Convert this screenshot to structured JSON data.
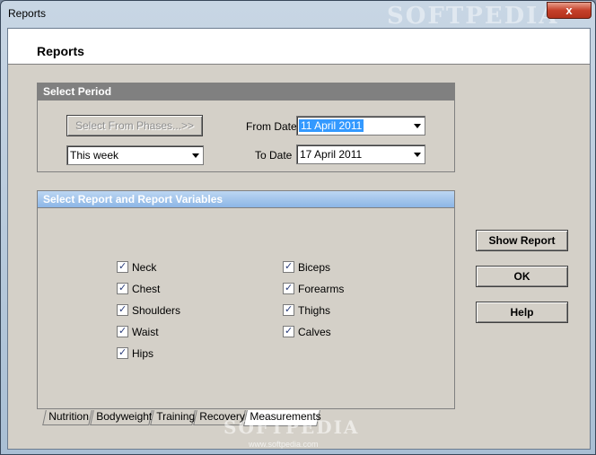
{
  "window": {
    "title": "Reports",
    "watermark": "SOFTPEDIA",
    "close_label": "x"
  },
  "header": {
    "title": "Reports"
  },
  "select_period": {
    "title": "Select Period",
    "phases_button": "Select From Phases...>>",
    "range_select": "This week",
    "from_label": "From Date",
    "from_value": "11 April 2011",
    "to_label": "To Date",
    "to_value": "17 April 2011"
  },
  "report_vars": {
    "title": "Select Report and Report Variables",
    "left": [
      {
        "label": "Neck",
        "checked": true
      },
      {
        "label": "Chest",
        "checked": true
      },
      {
        "label": "Shoulders",
        "checked": true
      },
      {
        "label": "Waist",
        "checked": true
      },
      {
        "label": "Hips",
        "checked": true
      }
    ],
    "right": [
      {
        "label": "Biceps",
        "checked": true
      },
      {
        "label": "Forearms",
        "checked": true
      },
      {
        "label": "Thighs",
        "checked": true
      },
      {
        "label": "Calves",
        "checked": true
      }
    ]
  },
  "tabs": [
    "Nutrition",
    "Bodyweight",
    "Training",
    "Recovery",
    "Measurements"
  ],
  "active_tab": "Measurements",
  "buttons": {
    "show_report": "Show Report",
    "ok": "OK",
    "help": "Help"
  },
  "footer_watermark": {
    "main": "SOFTPEDIA",
    "sub": "www.softpedia.com"
  }
}
